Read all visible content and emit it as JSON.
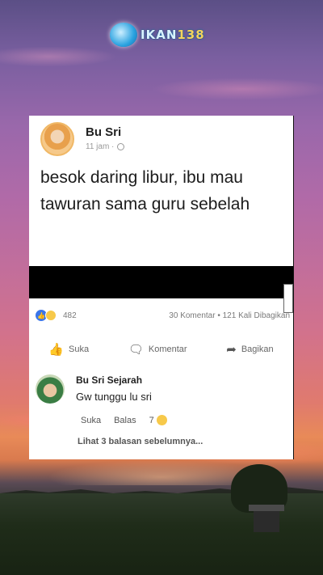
{
  "logo": {
    "text_main": "IKAN",
    "text_number": "138"
  },
  "post": {
    "author": "Bu Sri",
    "time": "11 jam ·",
    "body": "besok daring libur, ibu mau tawuran sama guru sebelah",
    "reactions_count": "482",
    "stats": "30 Komentar • 121 Kali Dibagikan"
  },
  "actions": {
    "like": "Suka",
    "comment": "Komentar",
    "share": "Bagikan"
  },
  "comment": {
    "author": "Bu Sri Sejarah",
    "text": "Gw tunggu lu sri",
    "like": "Suka",
    "reply": "Balas",
    "reaction_count": "7",
    "more_replies": "Lihat 3 balasan sebelumnya..."
  },
  "colors": {
    "accent": "#3b75e8",
    "haha": "#f7c94a"
  }
}
